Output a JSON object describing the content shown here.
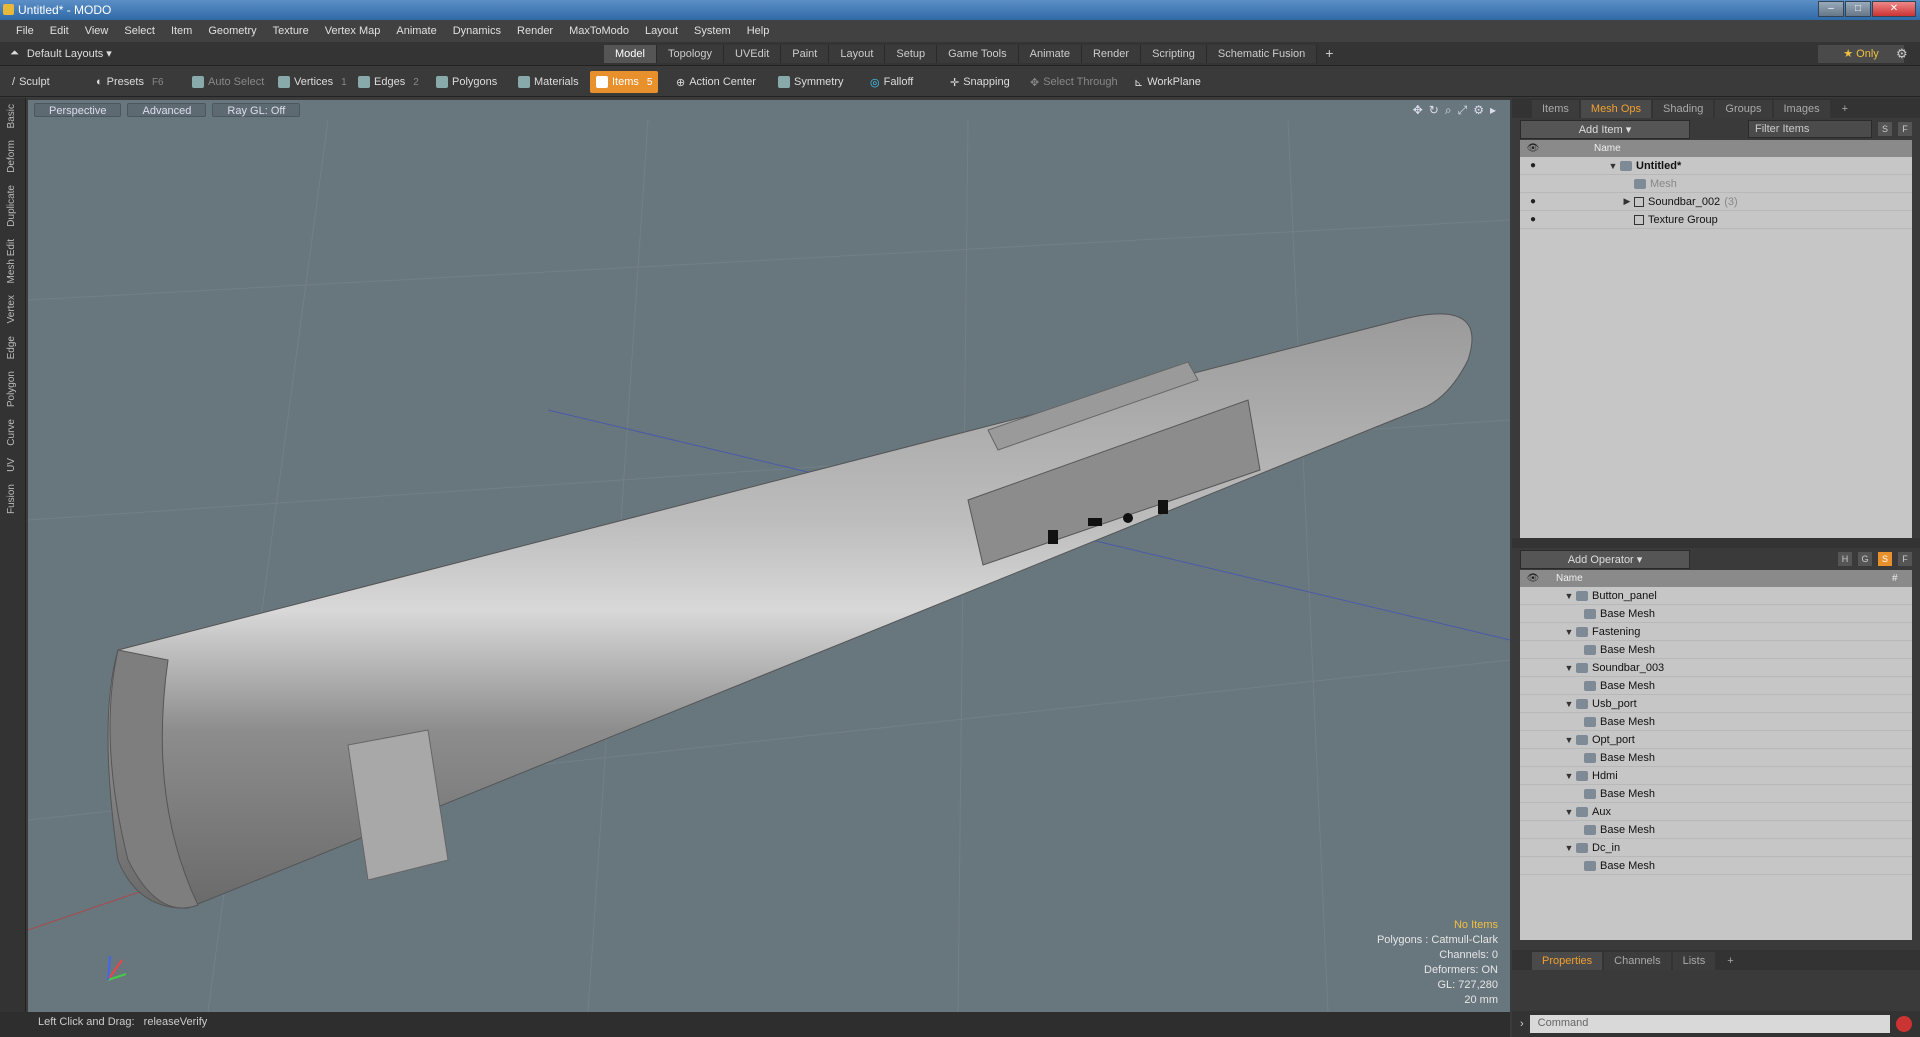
{
  "window": {
    "title": "Untitled* - MODO"
  },
  "menu": [
    "File",
    "Edit",
    "View",
    "Select",
    "Item",
    "Geometry",
    "Texture",
    "Vertex Map",
    "Animate",
    "Dynamics",
    "Render",
    "MaxToModo",
    "Layout",
    "System",
    "Help"
  ],
  "layouts": {
    "label": "Default Layouts",
    "only": "Only"
  },
  "tabs": [
    "Model",
    "Topology",
    "UVEdit",
    "Paint",
    "Layout",
    "Setup",
    "Game Tools",
    "Animate",
    "Render",
    "Scripting",
    "Schematic Fusion"
  ],
  "tools": {
    "sculpt": "Sculpt",
    "presets": "Presets",
    "presets_key": "F6",
    "auto_select": "Auto Select",
    "vertices": "Vertices",
    "vertices_n": "1",
    "edges": "Edges",
    "edges_n": "2",
    "polygons": "Polygons",
    "materials": "Materials",
    "items": "Items",
    "items_n": "5",
    "action_center": "Action Center",
    "symmetry": "Symmetry",
    "falloff": "Falloff",
    "snapping": "Snapping",
    "select_through": "Select Through",
    "workplane": "WorkPlane"
  },
  "left_tabs": [
    "Basic",
    "Deform",
    "Duplicate",
    "Mesh Edit",
    "Vertex",
    "Edge",
    "Polygon",
    "Curve",
    "UV",
    "Fusion"
  ],
  "viewport": {
    "view": "Perspective",
    "shading": "Advanced",
    "raygl": "Ray GL: Off",
    "info": {
      "items": "No Items",
      "polygons": "Polygons : Catmull-Clark",
      "channels": "Channels: 0",
      "deformers": "Deformers: ON",
      "gl": "GL: 727,280",
      "scale": "20 mm"
    }
  },
  "status": {
    "hint": "Left Click and Drag:",
    "value": "releaseVerify"
  },
  "items_panel": {
    "tabs": [
      "Items",
      "Mesh Ops",
      "Shading",
      "Groups",
      "Images"
    ],
    "add": "Add Item",
    "filter": "Filter Items",
    "header": "Name",
    "rows": [
      {
        "name": "Untitled*"
      },
      {
        "name": "Mesh"
      },
      {
        "name": "Soundbar_002",
        "count": "(3)"
      },
      {
        "name": "Texture Group"
      }
    ]
  },
  "ops_panel": {
    "add": "Add Operator",
    "header": "Name",
    "hash": "#",
    "rows": [
      {
        "name": "Button_panel",
        "child": "Base Mesh"
      },
      {
        "name": "Fastening",
        "child": "Base Mesh"
      },
      {
        "name": "Soundbar_003",
        "child": "Base Mesh"
      },
      {
        "name": "Usb_port",
        "child": "Base Mesh"
      },
      {
        "name": "Opt_port",
        "child": "Base Mesh"
      },
      {
        "name": "Hdmi",
        "child": "Base Mesh"
      },
      {
        "name": "Aux",
        "child": "Base Mesh"
      },
      {
        "name": "Dc_in",
        "child": "Base Mesh"
      }
    ]
  },
  "props_panel": {
    "tabs": [
      "Properties",
      "Channels",
      "Lists"
    ]
  },
  "command": {
    "placeholder": "Command"
  }
}
